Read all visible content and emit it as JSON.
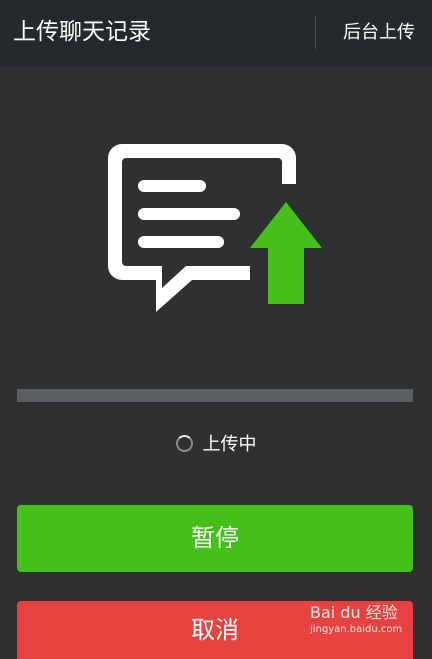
{
  "header": {
    "title": "上传聊天记录",
    "background_upload_label": "后台上传"
  },
  "illustration": {
    "icon": "chat-record-upload-icon",
    "arrow_color": "#45c01a",
    "bubble_color": "#ffffff"
  },
  "progress": {
    "fraction": 0.0,
    "track_color": "#5c5f61",
    "fill_color": "#45c01a"
  },
  "status": {
    "label": "上传中",
    "icon": "loading-spinner-icon"
  },
  "buttons": {
    "pause_label": "暂停",
    "pause_color": "#45c01a",
    "cancel_label": "取消",
    "cancel_color": "#e64340"
  },
  "watermark": {
    "brand": "Bai du 经验",
    "url": "jingyan.baidu.com"
  }
}
